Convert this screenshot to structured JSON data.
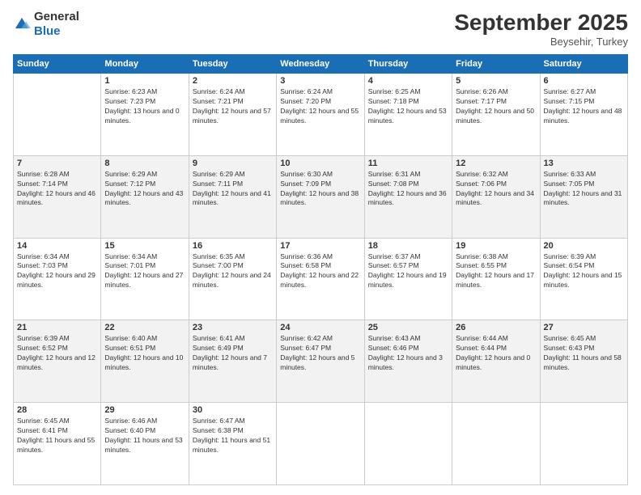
{
  "logo": {
    "text_general": "General",
    "text_blue": "Blue"
  },
  "header": {
    "month": "September 2025",
    "location": "Beysehir, Turkey"
  },
  "weekdays": [
    "Sunday",
    "Monday",
    "Tuesday",
    "Wednesday",
    "Thursday",
    "Friday",
    "Saturday"
  ],
  "weeks": [
    [
      {
        "day": "",
        "sunrise": "",
        "sunset": "",
        "daylight": ""
      },
      {
        "day": "1",
        "sunrise": "Sunrise: 6:23 AM",
        "sunset": "Sunset: 7:23 PM",
        "daylight": "Daylight: 13 hours and 0 minutes."
      },
      {
        "day": "2",
        "sunrise": "Sunrise: 6:24 AM",
        "sunset": "Sunset: 7:21 PM",
        "daylight": "Daylight: 12 hours and 57 minutes."
      },
      {
        "day": "3",
        "sunrise": "Sunrise: 6:24 AM",
        "sunset": "Sunset: 7:20 PM",
        "daylight": "Daylight: 12 hours and 55 minutes."
      },
      {
        "day": "4",
        "sunrise": "Sunrise: 6:25 AM",
        "sunset": "Sunset: 7:18 PM",
        "daylight": "Daylight: 12 hours and 53 minutes."
      },
      {
        "day": "5",
        "sunrise": "Sunrise: 6:26 AM",
        "sunset": "Sunset: 7:17 PM",
        "daylight": "Daylight: 12 hours and 50 minutes."
      },
      {
        "day": "6",
        "sunrise": "Sunrise: 6:27 AM",
        "sunset": "Sunset: 7:15 PM",
        "daylight": "Daylight: 12 hours and 48 minutes."
      }
    ],
    [
      {
        "day": "7",
        "sunrise": "Sunrise: 6:28 AM",
        "sunset": "Sunset: 7:14 PM",
        "daylight": "Daylight: 12 hours and 46 minutes."
      },
      {
        "day": "8",
        "sunrise": "Sunrise: 6:29 AM",
        "sunset": "Sunset: 7:12 PM",
        "daylight": "Daylight: 12 hours and 43 minutes."
      },
      {
        "day": "9",
        "sunrise": "Sunrise: 6:29 AM",
        "sunset": "Sunset: 7:11 PM",
        "daylight": "Daylight: 12 hours and 41 minutes."
      },
      {
        "day": "10",
        "sunrise": "Sunrise: 6:30 AM",
        "sunset": "Sunset: 7:09 PM",
        "daylight": "Daylight: 12 hours and 38 minutes."
      },
      {
        "day": "11",
        "sunrise": "Sunrise: 6:31 AM",
        "sunset": "Sunset: 7:08 PM",
        "daylight": "Daylight: 12 hours and 36 minutes."
      },
      {
        "day": "12",
        "sunrise": "Sunrise: 6:32 AM",
        "sunset": "Sunset: 7:06 PM",
        "daylight": "Daylight: 12 hours and 34 minutes."
      },
      {
        "day": "13",
        "sunrise": "Sunrise: 6:33 AM",
        "sunset": "Sunset: 7:05 PM",
        "daylight": "Daylight: 12 hours and 31 minutes."
      }
    ],
    [
      {
        "day": "14",
        "sunrise": "Sunrise: 6:34 AM",
        "sunset": "Sunset: 7:03 PM",
        "daylight": "Daylight: 12 hours and 29 minutes."
      },
      {
        "day": "15",
        "sunrise": "Sunrise: 6:34 AM",
        "sunset": "Sunset: 7:01 PM",
        "daylight": "Daylight: 12 hours and 27 minutes."
      },
      {
        "day": "16",
        "sunrise": "Sunrise: 6:35 AM",
        "sunset": "Sunset: 7:00 PM",
        "daylight": "Daylight: 12 hours and 24 minutes."
      },
      {
        "day": "17",
        "sunrise": "Sunrise: 6:36 AM",
        "sunset": "Sunset: 6:58 PM",
        "daylight": "Daylight: 12 hours and 22 minutes."
      },
      {
        "day": "18",
        "sunrise": "Sunrise: 6:37 AM",
        "sunset": "Sunset: 6:57 PM",
        "daylight": "Daylight: 12 hours and 19 minutes."
      },
      {
        "day": "19",
        "sunrise": "Sunrise: 6:38 AM",
        "sunset": "Sunset: 6:55 PM",
        "daylight": "Daylight: 12 hours and 17 minutes."
      },
      {
        "day": "20",
        "sunrise": "Sunrise: 6:39 AM",
        "sunset": "Sunset: 6:54 PM",
        "daylight": "Daylight: 12 hours and 15 minutes."
      }
    ],
    [
      {
        "day": "21",
        "sunrise": "Sunrise: 6:39 AM",
        "sunset": "Sunset: 6:52 PM",
        "daylight": "Daylight: 12 hours and 12 minutes."
      },
      {
        "day": "22",
        "sunrise": "Sunrise: 6:40 AM",
        "sunset": "Sunset: 6:51 PM",
        "daylight": "Daylight: 12 hours and 10 minutes."
      },
      {
        "day": "23",
        "sunrise": "Sunrise: 6:41 AM",
        "sunset": "Sunset: 6:49 PM",
        "daylight": "Daylight: 12 hours and 7 minutes."
      },
      {
        "day": "24",
        "sunrise": "Sunrise: 6:42 AM",
        "sunset": "Sunset: 6:47 PM",
        "daylight": "Daylight: 12 hours and 5 minutes."
      },
      {
        "day": "25",
        "sunrise": "Sunrise: 6:43 AM",
        "sunset": "Sunset: 6:46 PM",
        "daylight": "Daylight: 12 hours and 3 minutes."
      },
      {
        "day": "26",
        "sunrise": "Sunrise: 6:44 AM",
        "sunset": "Sunset: 6:44 PM",
        "daylight": "Daylight: 12 hours and 0 minutes."
      },
      {
        "day": "27",
        "sunrise": "Sunrise: 6:45 AM",
        "sunset": "Sunset: 6:43 PM",
        "daylight": "Daylight: 11 hours and 58 minutes."
      }
    ],
    [
      {
        "day": "28",
        "sunrise": "Sunrise: 6:45 AM",
        "sunset": "Sunset: 6:41 PM",
        "daylight": "Daylight: 11 hours and 55 minutes."
      },
      {
        "day": "29",
        "sunrise": "Sunrise: 6:46 AM",
        "sunset": "Sunset: 6:40 PM",
        "daylight": "Daylight: 11 hours and 53 minutes."
      },
      {
        "day": "30",
        "sunrise": "Sunrise: 6:47 AM",
        "sunset": "Sunset: 6:38 PM",
        "daylight": "Daylight: 11 hours and 51 minutes."
      },
      {
        "day": "",
        "sunrise": "",
        "sunset": "",
        "daylight": ""
      },
      {
        "day": "",
        "sunrise": "",
        "sunset": "",
        "daylight": ""
      },
      {
        "day": "",
        "sunrise": "",
        "sunset": "",
        "daylight": ""
      },
      {
        "day": "",
        "sunrise": "",
        "sunset": "",
        "daylight": ""
      }
    ]
  ]
}
